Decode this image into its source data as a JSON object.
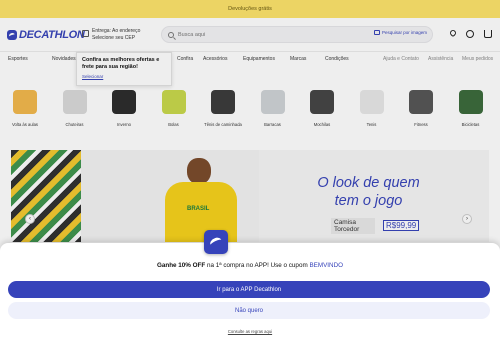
{
  "promo_bar": {
    "text": "Devoluções grátis"
  },
  "header": {
    "logo": "DECATHLON",
    "delivery_line1": "Entrega: Ao endereço",
    "delivery_line2": "Selecione seu CEP",
    "search_placeholder": "Busca aqui",
    "search_photo": "Pesquisar por imagem",
    "icons": [
      "heart-icon",
      "user-icon",
      "cart-icon"
    ]
  },
  "nav": {
    "items": [
      "Esportes",
      "Novidades",
      "Confira",
      "Acessórios",
      "Equipamentos",
      "Marcas",
      "Condições"
    ],
    "right_items": [
      "Ajuda e Contato",
      "Assistência",
      "Meus pedidos"
    ]
  },
  "location_popover": {
    "line1": "Confira as melhores ofertas e",
    "line2": "frete para sua região!",
    "link": "Selecionar"
  },
  "categories": [
    {
      "label": "Volta às aulas",
      "color": "#f2b84b"
    },
    {
      "label": "Chuteiras",
      "color": "#d9d9d9"
    },
    {
      "label": "Inverno",
      "color": "#2b2b2b"
    },
    {
      "label": "Bolas",
      "color": "#c8d84a"
    },
    {
      "label": "Tênis de caminhada",
      "color": "#3a3a3a"
    },
    {
      "label": "Barracas",
      "color": "#cfd3d6"
    },
    {
      "label": "Mochilas",
      "color": "#444444"
    },
    {
      "label": "Tenis",
      "color": "#e8e8e8"
    },
    {
      "label": "Fitness",
      "color": "#555555"
    },
    {
      "label": "Bicicletas",
      "color": "#3a6a3a"
    }
  ],
  "hero": {
    "headline_line1": "O look de quem",
    "headline_line2": "tem o jogo",
    "shirt_text": "BRASIL",
    "tag_line1": "Camisa",
    "tag_line2": "Torcedor",
    "price": "R$99,99",
    "prev_arrow": "‹",
    "next_arrow": "›"
  },
  "app_sheet": {
    "offer_bold": "Ganhe 10% OFF",
    "offer_text": " na 1ª compra no APP! Use o cupom ",
    "offer_code": "BEMVINDO",
    "primary_button": "Ir para o APP Decathlon",
    "secondary_button": "Não quero",
    "rules_link": "Consulte as regras aqui",
    "accent": "#3643ba"
  }
}
